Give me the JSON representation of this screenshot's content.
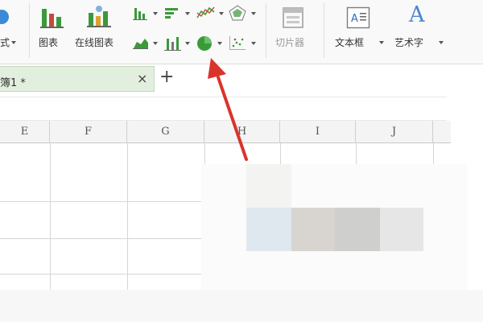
{
  "ribbon": {
    "partial_left_label": "式",
    "chart_button_label": "图表",
    "online_chart_label": "在线图表",
    "slicer_label": "切片器",
    "textbox_label": "文本框",
    "wordart_label": "艺术字",
    "wordart_glyph": "A",
    "textbox_glyph": "A≡"
  },
  "tabs": {
    "document_label": "簿1 *",
    "close_glyph": "×",
    "add_glyph": "+"
  },
  "grid": {
    "columns": [
      "E",
      "F",
      "G",
      "H",
      "I",
      "J"
    ]
  },
  "colors": {
    "accent_green": "#3a9a3a",
    "arrow_red": "#d9342b",
    "tab_active_bg": "#e3efde"
  },
  "icons": [
    "column-chart-icon",
    "online-chart-icon",
    "bar-chart-icon",
    "line-chart-icon",
    "radar-chart-icon",
    "area-chart-icon",
    "stock-chart-icon",
    "pie-chart-icon",
    "scatter-chart-icon",
    "slicer-icon",
    "textbox-icon",
    "wordart-icon",
    "annotation-arrow"
  ]
}
